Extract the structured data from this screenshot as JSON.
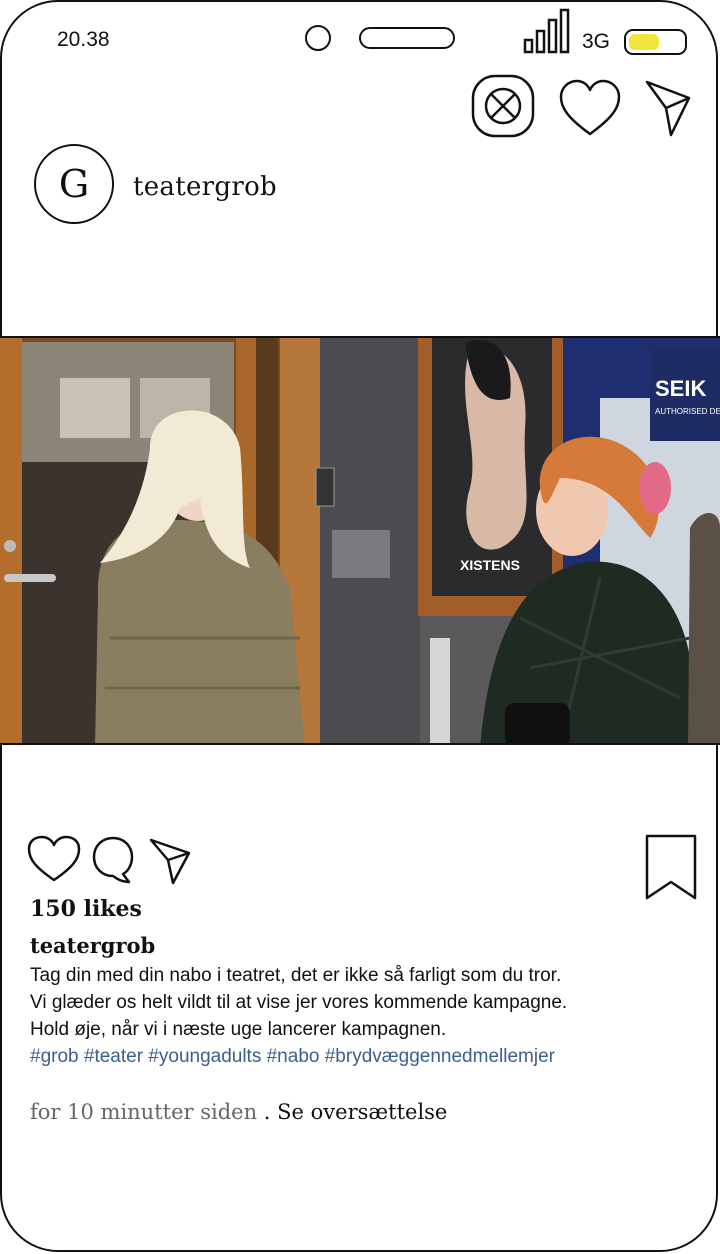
{
  "status_bar": {
    "time": "20.38",
    "network": "3G",
    "battery_color": "#f3e43b"
  },
  "header": {
    "avatar_letter": "G",
    "username": "teatergrob"
  },
  "photo": {
    "poster_text": "XISTENS",
    "shop_sign": "SEIK",
    "shop_sign_sub": "AUTHORISED DE"
  },
  "post": {
    "likes": "150 likes",
    "caption_user": "teatergrob",
    "caption_lines": [
      "Tag din med din nabo i teatret, det er ikke så farligt som du tror.",
      "Vi glæder os helt vildt til at vise jer vores kommende kampagne.",
      "Hold øje, når vi i næste uge lancerer kampagnen."
    ],
    "hashtags": "#grob #teater #youngadults #nabo #brydvæggennedmellemjer",
    "time_ago": "for 10 minutter siden",
    "separator": " . ",
    "translate": "Se oversættelse"
  },
  "colors": {
    "hashtag": "#3c5f8f",
    "outline": "#111111"
  }
}
